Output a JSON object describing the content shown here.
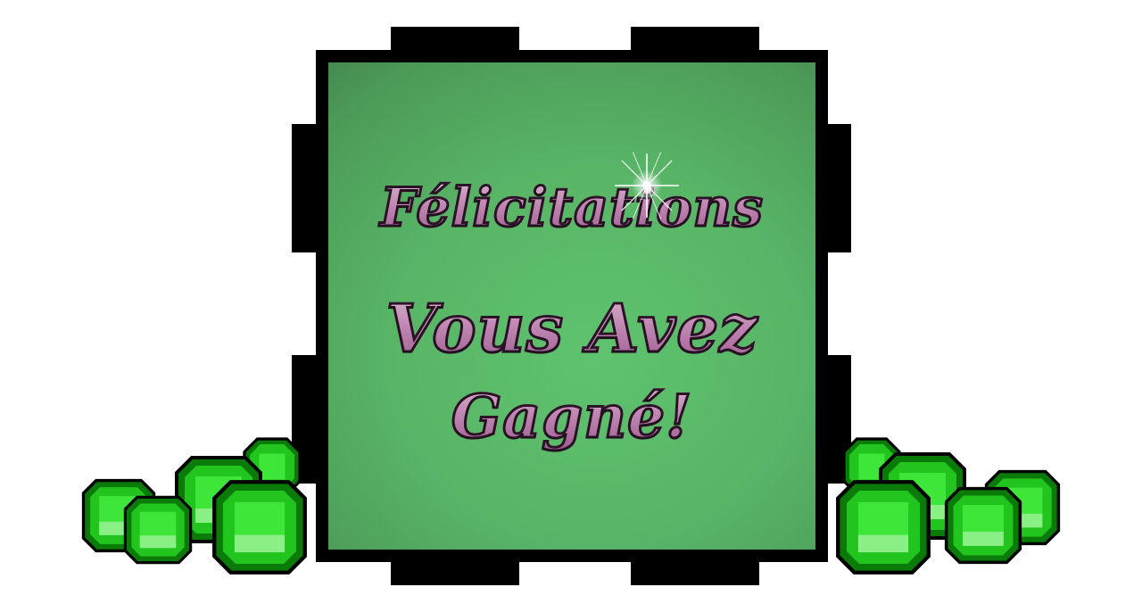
{
  "screen": {
    "heading_line_1": "Félicitations",
    "heading_line_2": "Vous Avez",
    "heading_line_3": "Gagné!"
  },
  "colors": {
    "frame": "#000000",
    "panel_light": "#5ec36e",
    "panel_dark": "#355a3a",
    "text_fill": "#e7a9d8",
    "gem_green": "#22c41e",
    "gem_dark": "#0d8a0c"
  },
  "icons": {
    "sparkle": "sparkle-icon",
    "gem": "emerald-gem-icon"
  }
}
